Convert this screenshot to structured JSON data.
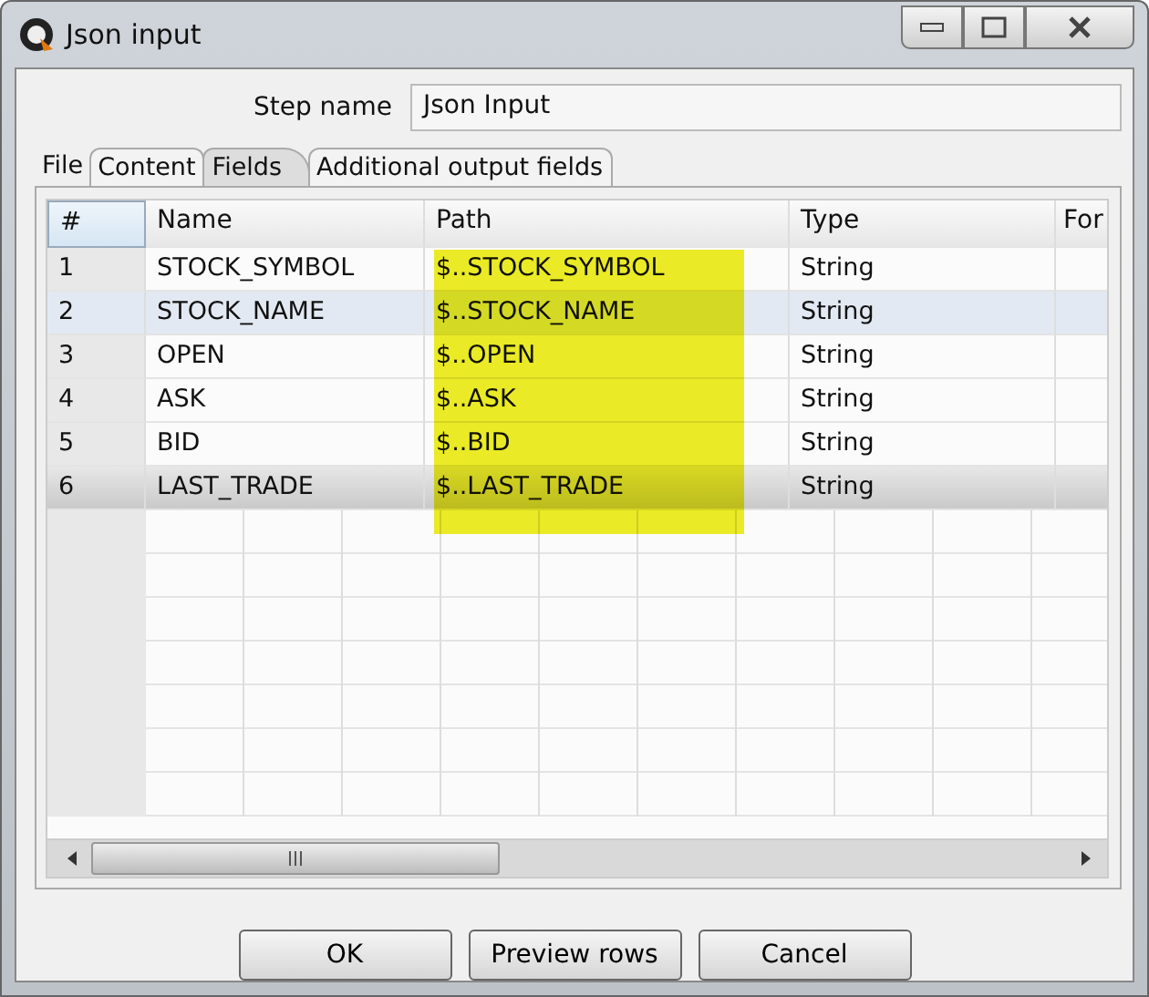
{
  "window": {
    "title": "Json input"
  },
  "step_name": {
    "label": "Step name",
    "value": "Json Input"
  },
  "tabs": [
    {
      "label": "File",
      "selected": false
    },
    {
      "label": "Content",
      "selected": false
    },
    {
      "label": "Fields",
      "selected": true
    },
    {
      "label": "Additional output fields",
      "selected": false
    }
  ],
  "table": {
    "columns": [
      "#",
      "Name",
      "Path",
      "Type",
      "For"
    ],
    "path_highlighted": true,
    "rows": [
      {
        "cells": [
          "1",
          "STOCK_SYMBOL",
          "$..STOCK_SYMBOL",
          "String"
        ],
        "selected": false,
        "focused": false
      },
      {
        "cells": [
          "2",
          "STOCK_NAME",
          "$..STOCK_NAME",
          "String"
        ],
        "selected": false,
        "focused": true
      },
      {
        "cells": [
          "3",
          "OPEN",
          "$..OPEN",
          "String"
        ],
        "selected": false,
        "focused": false
      },
      {
        "cells": [
          "4",
          "ASK",
          "$..ASK",
          "String"
        ],
        "selected": false,
        "focused": false
      },
      {
        "cells": [
          "5",
          "BID",
          "$..BID",
          "String"
        ],
        "selected": false,
        "focused": false
      },
      {
        "cells": [
          "6",
          "LAST_TRADE",
          "$..LAST_TRADE",
          "String"
        ],
        "selected": true,
        "focused": false
      }
    ]
  },
  "buttons": [
    "OK",
    "Preview rows",
    "Cancel"
  ]
}
